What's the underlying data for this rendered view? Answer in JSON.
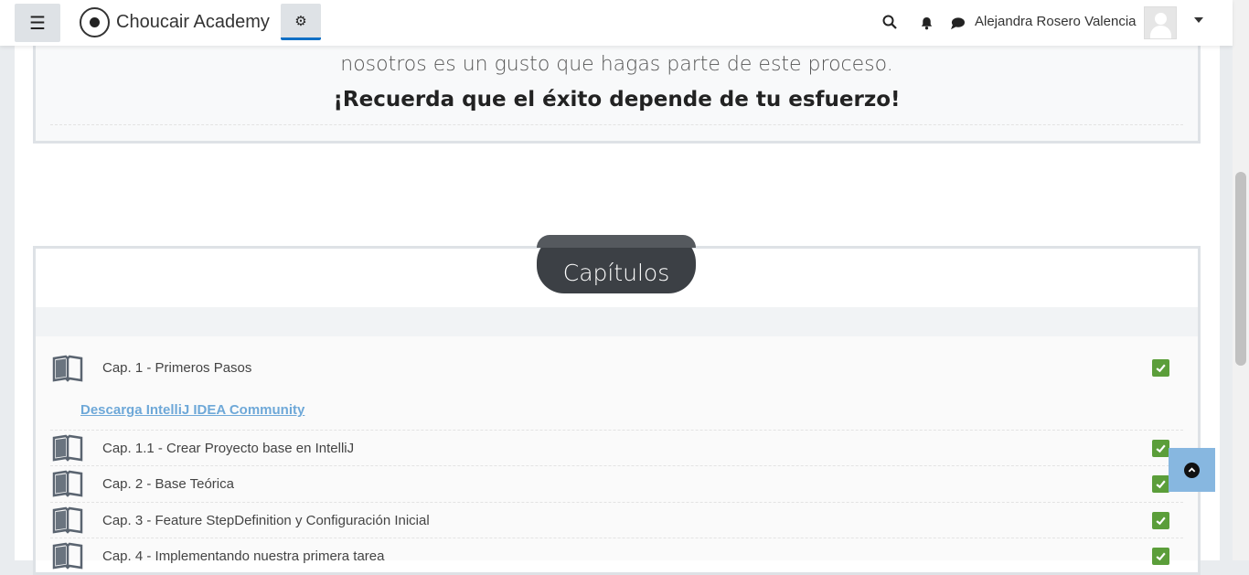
{
  "header": {
    "site_name": "Choucair Academy",
    "user_name": "Alejandra Rosero Valencia",
    "icons": [
      "menu-icon",
      "settings-icon",
      "search-icon",
      "bell-icon",
      "chat-icon",
      "avatar",
      "caret-down-icon"
    ]
  },
  "intro": {
    "partial_top": "nosotros es un gusto que hagas parte de este proceso.",
    "motto": "¡Recuerda que el éxito depende de tu esfuerzo!"
  },
  "chapters": {
    "title": "Capítulos",
    "download_link": "Descarga IntelliJ IDEA Community",
    "items": [
      {
        "label": "Cap. 1 - Primeros Pasos",
        "completed": true
      },
      {
        "label": "Cap. 1.1 - Crear Proyecto base en IntelliJ",
        "completed": true
      },
      {
        "label": "Cap. 2 - Base Teórica",
        "completed": true
      },
      {
        "label": "Cap. 3 - Feature StepDefinition y Configuración Inicial",
        "completed": true
      },
      {
        "label": "Cap. 4 - Implementando nuestra primera tarea",
        "completed": true
      }
    ]
  },
  "colors": {
    "check_green": "#5b9e3a",
    "link_blue": "#6ea8d8",
    "chapters_pill": "#3c4045",
    "back_to_top": "#87b7e0"
  }
}
